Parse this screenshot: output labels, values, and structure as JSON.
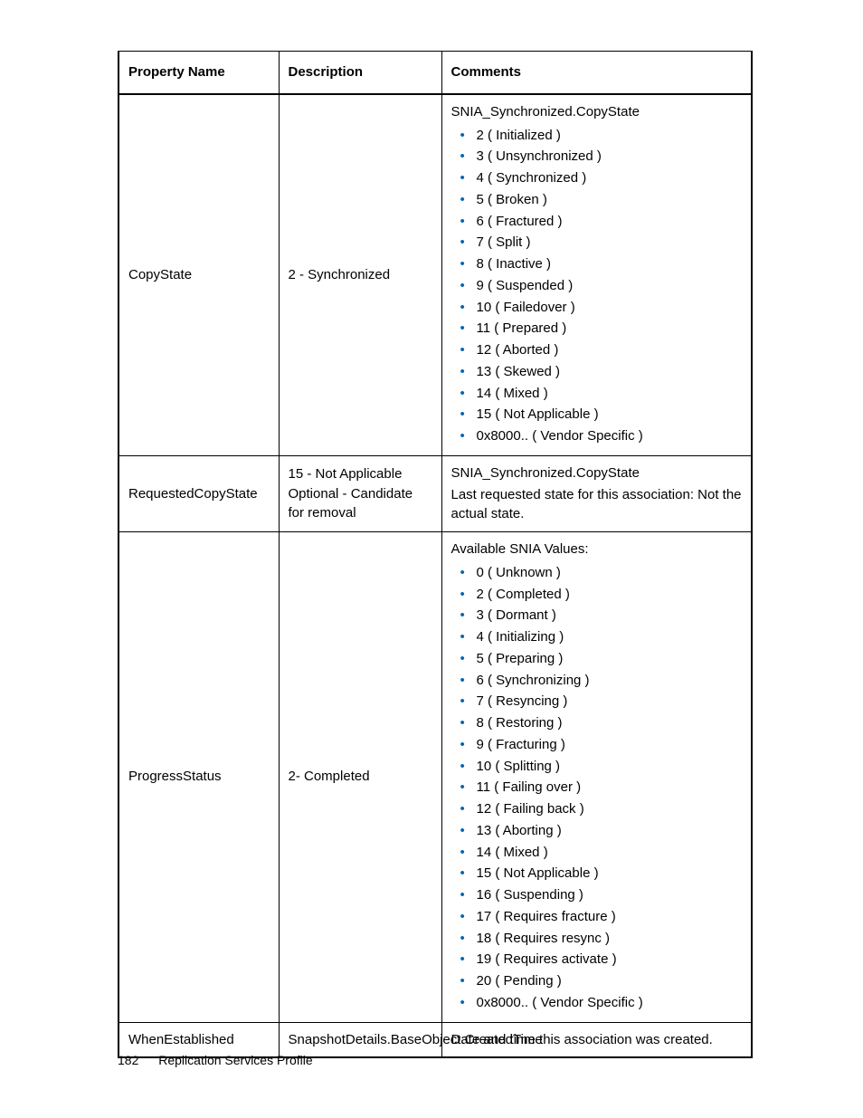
{
  "headers": {
    "c1": "Property Name",
    "c2": "Description",
    "c3": "Comments"
  },
  "rows": {
    "r1": {
      "name": "CopyState",
      "desc": "2 - Synchronized",
      "lead": "SNIA_Synchronized.CopyState",
      "items": [
        "2 ( Initialized )",
        "3 ( Unsynchronized )",
        "4 ( Synchronized )",
        "5 ( Broken )",
        "6 ( Fractured )",
        "7 ( Split )",
        "8 ( Inactive )",
        "9 ( Suspended )",
        "10 ( Failedover )",
        "11 ( Prepared )",
        "12 ( Aborted )",
        "13 ( Skewed )",
        "14 ( Mixed )",
        "15 ( Not Applicable )",
        "0x8000.. ( Vendor Specific )"
      ]
    },
    "r2": {
      "name": "RequestedCopyState",
      "desc_l1": "15 - Not Applicable",
      "desc_l2": "Optional - Candidate for removal",
      "lead": "SNIA_Synchronized.CopyState",
      "text": "Last requested state for this association: Not the actual state."
    },
    "r3": {
      "name": "ProgressStatus",
      "desc": "2- Completed",
      "lead": "Available SNIA Values:",
      "items": [
        "0 ( Unknown )",
        "2 ( Completed )",
        "3 ( Dormant )",
        "4 ( Initializing )",
        "5 ( Preparing )",
        "6 ( Synchronizing )",
        "7 ( Resyncing )",
        "8 ( Restoring )",
        "9 ( Fracturing )",
        "10 ( Splitting )",
        "11 ( Failing over )",
        "12 ( Failing back )",
        "13 ( Aborting )",
        "14 ( Mixed )",
        "15 ( Not Applicable )",
        "16 ( Suspending )",
        "17 ( Requires fracture )",
        "18 ( Requires resync )",
        "19 ( Requires activate )",
        "20 ( Pending )",
        "0x8000.. ( Vendor Specific )"
      ]
    },
    "r4": {
      "name": "WhenEstablished",
      "desc": "SnapshotDetails.BaseObject.CreatedTime",
      "text": "Date and time this association was created."
    }
  },
  "footer": {
    "page": "182",
    "section": "Replication Services Profile"
  }
}
